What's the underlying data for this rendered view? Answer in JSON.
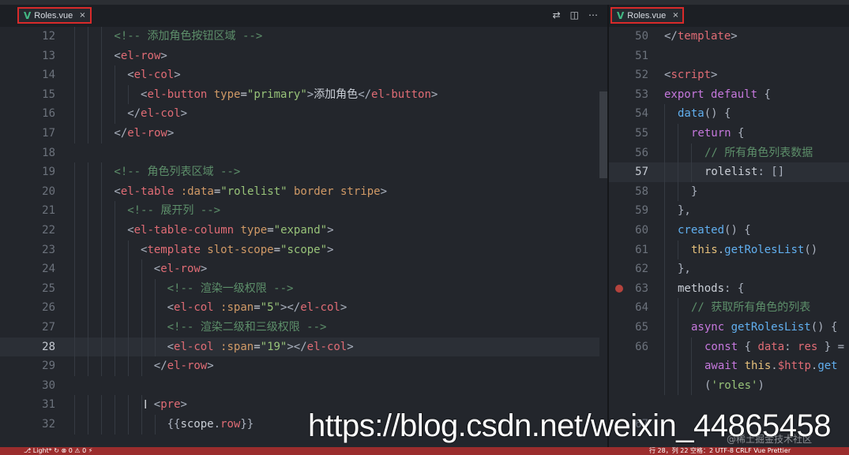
{
  "tabs": {
    "left": {
      "label": "Roles.vue",
      "close": "×"
    },
    "right": {
      "label": "Roles.vue",
      "close": "×"
    }
  },
  "editor_actions": [
    "⇄",
    "◫",
    "⋯"
  ],
  "left_lines": [
    {
      "n": "12",
      "segs": [
        [
          "com",
          "<!-- 添加角色按钮区域 -->"
        ]
      ],
      "indent": 3
    },
    {
      "n": "13",
      "segs": [
        [
          "br",
          "<"
        ],
        [
          "tag",
          "el-row"
        ],
        [
          "br",
          ">"
        ]
      ],
      "indent": 3
    },
    {
      "n": "14",
      "segs": [
        [
          "br",
          "<"
        ],
        [
          "tag",
          "el-col"
        ],
        [
          "br",
          ">"
        ]
      ],
      "indent": 4
    },
    {
      "n": "15",
      "segs": [
        [
          "br",
          "<"
        ],
        [
          "tag",
          "el-button "
        ],
        [
          "attr",
          "type"
        ],
        [
          "pl",
          "="
        ],
        [
          "str",
          "\"primary\""
        ],
        [
          "br",
          ">"
        ],
        [
          "pl",
          "添加角色"
        ],
        [
          "br",
          "</"
        ],
        [
          "tag",
          "el-button"
        ],
        [
          "br",
          ">"
        ]
      ],
      "indent": 5
    },
    {
      "n": "16",
      "segs": [
        [
          "br",
          "</"
        ],
        [
          "tag",
          "el-col"
        ],
        [
          "br",
          ">"
        ]
      ],
      "indent": 4
    },
    {
      "n": "17",
      "segs": [
        [
          "br",
          "</"
        ],
        [
          "tag",
          "el-row"
        ],
        [
          "br",
          ">"
        ]
      ],
      "indent": 3
    },
    {
      "n": "18",
      "segs": [],
      "indent": 0
    },
    {
      "n": "19",
      "segs": [
        [
          "com",
          "<!-- 角色列表区域 -->"
        ]
      ],
      "indent": 3
    },
    {
      "n": "20",
      "segs": [
        [
          "br",
          "<"
        ],
        [
          "tag",
          "el-table "
        ],
        [
          "attr",
          ":data"
        ],
        [
          "pl",
          "="
        ],
        [
          "str",
          "\"rolelist\""
        ],
        [
          "attr",
          " border stripe"
        ],
        [
          "br",
          ">"
        ]
      ],
      "indent": 3
    },
    {
      "n": "21",
      "segs": [
        [
          "com",
          "<!-- 展开列 -->"
        ]
      ],
      "indent": 4
    },
    {
      "n": "22",
      "segs": [
        [
          "br",
          "<"
        ],
        [
          "tag",
          "el-table-column "
        ],
        [
          "attr",
          "type"
        ],
        [
          "pl",
          "="
        ],
        [
          "str",
          "\"expand\""
        ],
        [
          "br",
          ">"
        ]
      ],
      "indent": 4
    },
    {
      "n": "23",
      "segs": [
        [
          "br",
          "<"
        ],
        [
          "tag",
          "template "
        ],
        [
          "attr",
          "slot-scope"
        ],
        [
          "pl",
          "="
        ],
        [
          "str",
          "\"scope\""
        ],
        [
          "br",
          ">"
        ]
      ],
      "indent": 5
    },
    {
      "n": "24",
      "segs": [
        [
          "br",
          "<"
        ],
        [
          "tag",
          "el-row"
        ],
        [
          "br",
          ">"
        ]
      ],
      "indent": 6
    },
    {
      "n": "25",
      "segs": [
        [
          "com",
          "<!-- 渲染一级权限 -->"
        ]
      ],
      "indent": 7
    },
    {
      "n": "26",
      "segs": [
        [
          "br",
          "<"
        ],
        [
          "tag",
          "el-col "
        ],
        [
          "attr",
          ":span"
        ],
        [
          "pl",
          "="
        ],
        [
          "str",
          "\"5\""
        ],
        [
          "br",
          "></"
        ],
        [
          "tag",
          "el-col"
        ],
        [
          "br",
          ">"
        ]
      ],
      "indent": 7
    },
    {
      "n": "27",
      "segs": [
        [
          "com",
          "<!-- 渲染二级和三级权限 -->"
        ]
      ],
      "indent": 7
    },
    {
      "n": "28",
      "segs": [
        [
          "br",
          "<"
        ],
        [
          "tag",
          "el-col "
        ],
        [
          "attr",
          ":span"
        ],
        [
          "pl",
          "="
        ],
        [
          "str",
          "\"19\""
        ],
        [
          "br",
          "></"
        ],
        [
          "tag",
          "el-col"
        ],
        [
          "br",
          ">"
        ]
      ],
      "indent": 7,
      "active": true
    },
    {
      "n": "29",
      "segs": [
        [
          "br",
          "</"
        ],
        [
          "tag",
          "el-row"
        ],
        [
          "br",
          ">"
        ]
      ],
      "indent": 6
    },
    {
      "n": "30",
      "segs": [],
      "indent": 0
    },
    {
      "n": "31",
      "segs": [
        [
          "br",
          "<"
        ],
        [
          "tag",
          "pre"
        ],
        [
          "br",
          ">"
        ]
      ],
      "indent": 6
    },
    {
      "n": "32",
      "segs": [
        [
          "br",
          "{{"
        ],
        [
          "pl",
          "scope"
        ],
        [
          "br",
          "."
        ],
        [
          "prop",
          "row"
        ],
        [
          "br",
          "}}"
        ]
      ],
      "indent": 7
    }
  ],
  "right_lines": [
    {
      "n": "50",
      "segs": [
        [
          "br",
          "</"
        ],
        [
          "tag",
          "template"
        ],
        [
          "br",
          ">"
        ]
      ],
      "indent": 0
    },
    {
      "n": "51",
      "segs": [],
      "indent": 0
    },
    {
      "n": "52",
      "segs": [
        [
          "br",
          "<"
        ],
        [
          "tag",
          "script"
        ],
        [
          "br",
          ">"
        ]
      ],
      "indent": 0
    },
    {
      "n": "53",
      "segs": [
        [
          "kw",
          "export default "
        ],
        [
          "br",
          "{"
        ]
      ],
      "indent": 0
    },
    {
      "n": "54",
      "segs": [
        [
          "fn",
          "data"
        ],
        [
          "br",
          "() {"
        ]
      ],
      "indent": 1
    },
    {
      "n": "55",
      "segs": [
        [
          "kw",
          "return "
        ],
        [
          "br",
          "{"
        ]
      ],
      "indent": 2
    },
    {
      "n": "56",
      "segs": [
        [
          "com",
          "// 所有角色列表数据"
        ]
      ],
      "indent": 3
    },
    {
      "n": "57",
      "segs": [
        [
          "pl",
          "rolelist"
        ],
        [
          "br",
          ": []"
        ]
      ],
      "indent": 3,
      "active": true
    },
    {
      "n": "58",
      "segs": [
        [
          "br",
          "}"
        ]
      ],
      "indent": 2
    },
    {
      "n": "59",
      "segs": [
        [
          "br",
          "},"
        ]
      ],
      "indent": 1
    },
    {
      "n": "60",
      "segs": [
        [
          "fn",
          "created"
        ],
        [
          "br",
          "() {"
        ]
      ],
      "indent": 1
    },
    {
      "n": "61",
      "segs": [
        [
          "this",
          "this"
        ],
        [
          "br",
          "."
        ],
        [
          "fn",
          "getRolesList"
        ],
        [
          "br",
          "()"
        ]
      ],
      "indent": 2
    },
    {
      "n": "62",
      "segs": [
        [
          "br",
          "},"
        ]
      ],
      "indent": 1
    },
    {
      "n": "63",
      "segs": [
        [
          "pl",
          "methods"
        ],
        [
          "br",
          ": {"
        ]
      ],
      "indent": 1,
      "breakpoint": true
    },
    {
      "n": "64",
      "segs": [
        [
          "com",
          "// 获取所有角色的列表"
        ]
      ],
      "indent": 2
    },
    {
      "n": "65",
      "segs": [
        [
          "kw",
          "async "
        ],
        [
          "fn",
          "getRolesList"
        ],
        [
          "br",
          "() {"
        ]
      ],
      "indent": 2
    },
    {
      "n": "66",
      "segs": [
        [
          "kw",
          "const "
        ],
        [
          "br",
          "{ "
        ],
        [
          "prop",
          "data"
        ],
        [
          "br",
          ": "
        ],
        [
          "prop",
          "res"
        ],
        [
          "br",
          " } ="
        ]
      ],
      "indent": 3
    },
    {
      "n": "",
      "segs": [
        [
          "kw",
          "await "
        ],
        [
          "this",
          "this"
        ],
        [
          "br",
          "."
        ],
        [
          "prop",
          "$http"
        ],
        [
          "br",
          "."
        ],
        [
          "fn",
          "get"
        ]
      ],
      "indent": 3
    },
    {
      "n": "",
      "segs": [
        [
          "br",
          "("
        ],
        [
          "str",
          "'roles'"
        ],
        [
          "br",
          ")"
        ]
      ],
      "indent": 3
    },
    {
      "n": "",
      "segs": [],
      "indent": 0
    },
    {
      "n": "67",
      "segs": [],
      "indent": 0
    }
  ],
  "overlay": {
    "watermark": "https://blog.csdn.net/weixin_44865458",
    "faint": "@稀土掘金技术社区",
    "cursor": "I"
  },
  "status": {
    "left": "⎇ Light*   ↻   ⊗ 0 ⚠ 0   ⚡",
    "right": "行 28，列 22   空格：2   UTF-8   CRLF   Vue   Prettier"
  }
}
